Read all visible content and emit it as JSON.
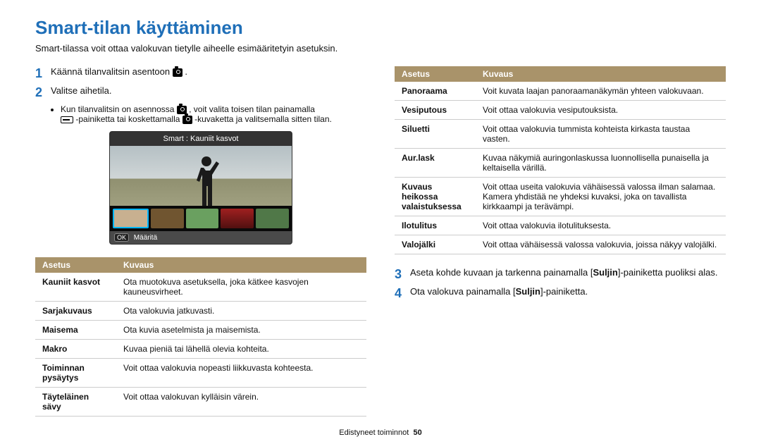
{
  "title": "Smart-tilan käyttäminen",
  "subtitle": "Smart-tilassa voit ottaa valokuvan tietylle aiheelle esimääritetyin asetuksin.",
  "steps": {
    "s1_num": "1",
    "s1_text": "Käännä tilanvalitsin asentoon ",
    "s1_tail": ".",
    "s2_num": "2",
    "s2_text": "Valitse aihetila.",
    "s2_bullet_a": "Kun tilanvalitsin on asennossa ",
    "s2_bullet_b": ", voit valita toisen tilan painamalla ",
    "s2_bullet_c": "-painiketta tai koskettamalla ",
    "s2_bullet_d": "-kuvaketta ja valitsemalla sitten tilan.",
    "s3_num": "3",
    "s3_a": "Aseta kohde kuvaan ja tarkenna painamalla [",
    "s3_b": "Suljin",
    "s3_c": "]-painiketta puoliksi alas.",
    "s4_num": "4",
    "s4_a": "Ota valokuva painamalla [",
    "s4_b": "Suljin",
    "s4_c": "]-painiketta."
  },
  "preview": {
    "bar": "Smart : Kauniit kasvot",
    "ok": "OK",
    "footer_text": "Määritä"
  },
  "table_head": {
    "a": "Asetus",
    "b": "Kuvaus"
  },
  "left_rows": [
    {
      "a": "Kauniit kasvot",
      "b": "Ota muotokuva asetuksella, joka kätkee kasvojen kauneusvirheet."
    },
    {
      "a": "Sarjakuvaus",
      "b": "Ota valokuvia jatkuvasti."
    },
    {
      "a": "Maisema",
      "b": "Ota kuvia asetelmista ja maisemista."
    },
    {
      "a": "Makro",
      "b": "Kuvaa pieniä tai lähellä olevia kohteita."
    },
    {
      "a": "Toiminnan pysäytys",
      "b": "Voit ottaa valokuvia nopeasti liikkuvasta kohteesta."
    },
    {
      "a": "Täyteläinen sävy",
      "b": "Voit ottaa valokuvan kylläisin värein."
    }
  ],
  "right_rows": [
    {
      "a": "Panoraama",
      "b": "Voit kuvata laajan panoraamanäkymän yhteen valokuvaan."
    },
    {
      "a": "Vesiputous",
      "b": "Voit ottaa valokuvia vesiputouksista."
    },
    {
      "a": "Siluetti",
      "b": "Voit ottaa valokuvia tummista kohteista kirkasta taustaa vasten."
    },
    {
      "a": "Aur.lask",
      "b": "Kuvaa näkymiä auringonlaskussa luonnollisella punaisella ja keltaisella värillä."
    },
    {
      "a": "Kuvaus heikossa valaistuksessa",
      "b": "Voit ottaa useita valokuvia vähäisessä valossa ilman salamaa. Kamera yhdistää ne yhdeksi kuvaksi, joka on tavallista kirkkaampi ja terävämpi."
    },
    {
      "a": "Ilotulitus",
      "b": "Voit ottaa valokuvia ilotulituksesta."
    },
    {
      "a": "Valojälki",
      "b": "Voit ottaa vähäisessä valossa valokuvia, joissa näkyy valojälki."
    }
  ],
  "footer": {
    "section": "Edistyneet toiminnot",
    "page": "50"
  }
}
